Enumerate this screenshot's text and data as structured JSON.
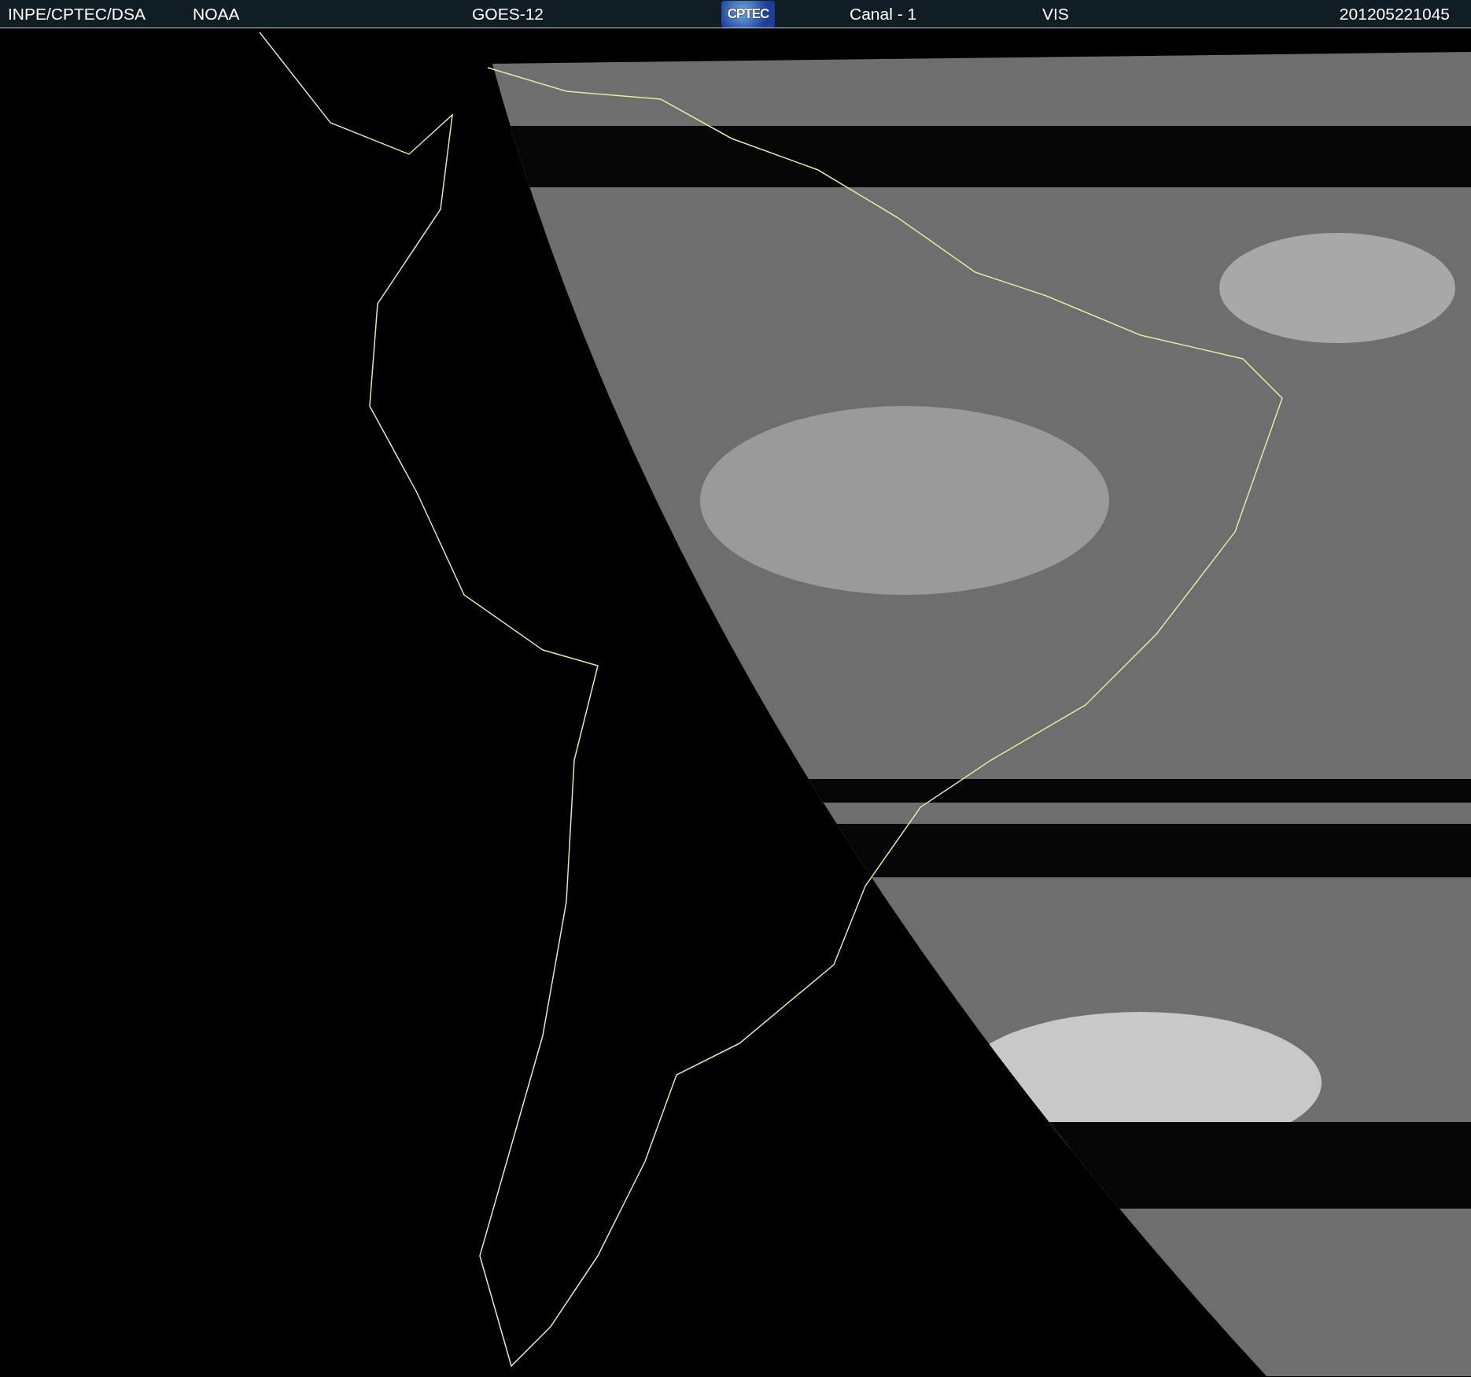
{
  "header": {
    "items": [
      {
        "kind": "text",
        "text": "INPE/CPTEC/DSA"
      },
      {
        "kind": "text",
        "text": "NOAA"
      },
      {
        "kind": "text",
        "text": "GOES-12"
      },
      {
        "kind": "logo",
        "text": "CPTEC"
      },
      {
        "kind": "text",
        "text": "Canal - 1"
      },
      {
        "kind": "text",
        "text": "VIS"
      },
      {
        "kind": "text",
        "text": "201205221045"
      }
    ]
  }
}
